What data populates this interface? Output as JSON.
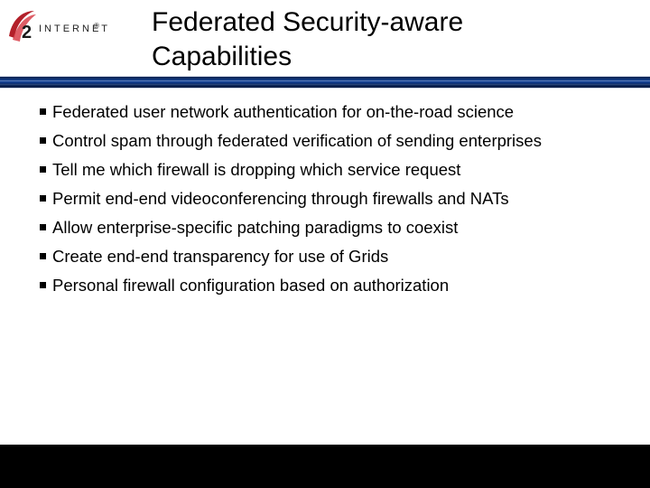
{
  "logo": {
    "word": "INTERNET",
    "registered": "®"
  },
  "title_line1": "Federated Security-aware",
  "title_line2": "Capabilities",
  "bullets": [
    "Federated user network authentication for on-the-road science",
    "Control spam through federated verification of sending enterprises",
    "Tell me which firewall is dropping which service request",
    "Permit end-end videoconferencing through firewalls and NATs",
    "Allow enterprise-specific patching paradigms to coexist",
    "Create end-end transparency for use of Grids",
    "Personal firewall configuration based on authorization"
  ]
}
